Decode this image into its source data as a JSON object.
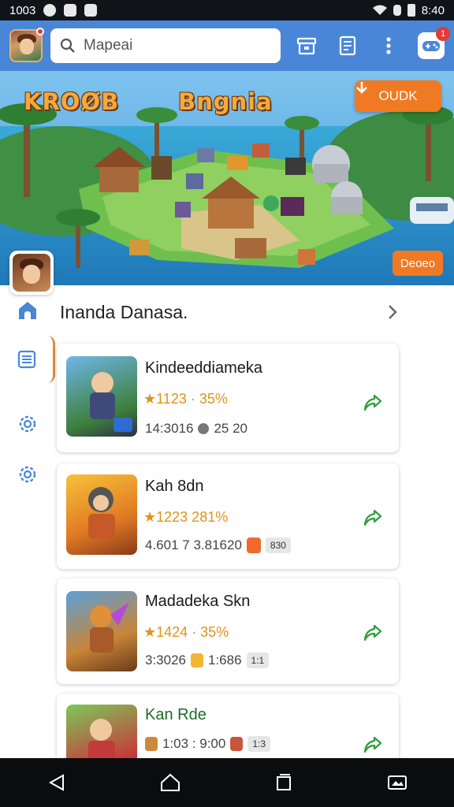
{
  "status_bar": {
    "time": "1003",
    "battery": "8:40"
  },
  "search": {
    "placeholder": "Mapeai"
  },
  "header": {
    "notification_count": "1"
  },
  "banner": {
    "title_left": "KROØB",
    "title_right": "Bngnia",
    "download_label": "OUDK",
    "tag_label": "Deoeo"
  },
  "section": {
    "title": "Inanda Danasa."
  },
  "games": [
    {
      "name": "Kindeeddiameka",
      "rating": "★1123 · 35%",
      "meta_a": "14:3016",
      "meta_b": "25 20",
      "name_color": "default"
    },
    {
      "name": "Kah 8dn",
      "rating": "★1223 281%",
      "meta_a": "4.601 7 3.81620",
      "meta_b": "830",
      "name_color": "default"
    },
    {
      "name": "Madadeka Skn",
      "rating": "★1424 · 35%",
      "meta_a": "3:3026",
      "meta_b": "1:686",
      "meta_c": "1:1",
      "name_color": "default"
    },
    {
      "name": "Kan Rde",
      "rating": "",
      "meta_a": "1:03 : 9:00",
      "meta_b": "1:3",
      "name_color": "green"
    }
  ],
  "colors": {
    "primary": "#4a86d8",
    "accent": "#f07a23",
    "share": "#2e9e3e"
  },
  "icons": {
    "back": "back-icon",
    "home": "home-icon",
    "recents": "recents-icon",
    "screenshot": "screenshot-icon"
  }
}
